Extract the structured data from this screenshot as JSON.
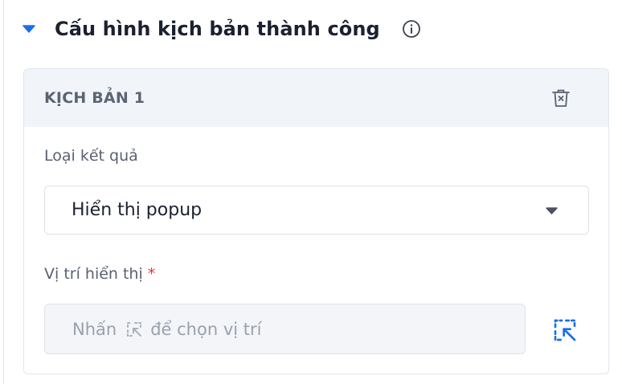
{
  "section": {
    "title": "Cấu hình kịch bản thành công"
  },
  "scenario": {
    "title": "KỊCH BẢN 1",
    "result_type": {
      "label": "Loại kết quả",
      "value": "Hiển thị popup"
    },
    "display_position": {
      "label": "Vị trí hiển thị",
      "required_mark": "*",
      "placeholder_before": "Nhấn",
      "placeholder_after": "để chọn vị trí"
    }
  },
  "icons": {
    "collapse": "caret-down-icon",
    "info": "info-circle-icon",
    "delete": "trash-icon",
    "picker": "dashed-cursor-select-icon"
  },
  "colors": {
    "accent": "#1a6fe8",
    "required": "#e5343a",
    "header_bg": "#f1f5fa"
  }
}
